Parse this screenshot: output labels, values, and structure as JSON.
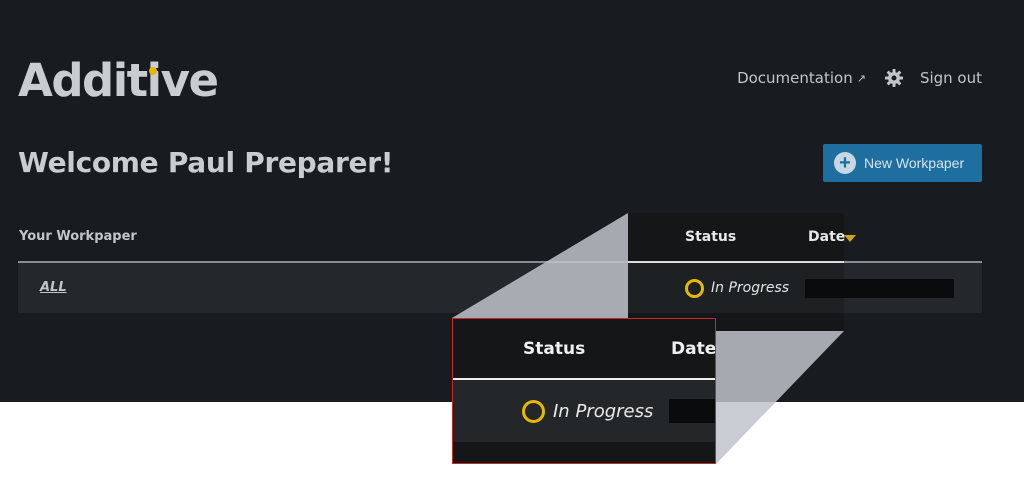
{
  "brand": {
    "name": "Additive",
    "accent_color": "#e6b800"
  },
  "nav": {
    "documentation_label": "Documentation",
    "documentation_icon": "external-link-icon",
    "settings_icon": "gear-icon",
    "signout_label": "Sign out"
  },
  "main": {
    "welcome": "Welcome Paul Preparer!",
    "new_button_label": "New Workpaper",
    "new_button_icon": "plus-circle-icon",
    "new_button_color": "#1e6fa0"
  },
  "table": {
    "columns": {
      "workpaper": "Your Workpaper",
      "status": "Status",
      "date": "Date"
    },
    "sort_icon": "sort-down-icon",
    "rows": [
      {
        "name": "ALL",
        "status": "In Progress",
        "status_icon": "progress-ring-icon",
        "status_color": "#e6b800"
      }
    ]
  },
  "callout": {
    "columns": {
      "status": "Status",
      "date": "Date"
    },
    "row": {
      "status": "In Progress"
    },
    "border_color": "#c62828"
  }
}
